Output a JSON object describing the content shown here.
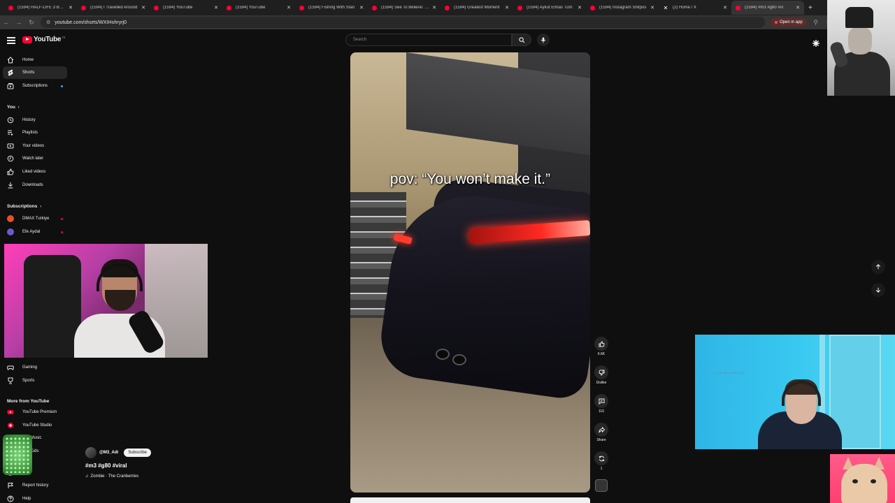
{
  "browser": {
    "tabs": [
      {
        "label": "(1594) HALF-LIFE 3 BU Ç",
        "active": false
      },
      {
        "label": "(1594) I Travelled Around",
        "active": false
      },
      {
        "label": "(1594) YouTube",
        "active": false
      },
      {
        "label": "(1594) YouTube",
        "active": false
      },
      {
        "label": "(1594) Fishing With Stan",
        "active": false
      },
      {
        "label": "(1594) See To Believe: De",
        "active": false
      },
      {
        "label": "(1594) Greatest Moment",
        "active": false
      },
      {
        "label": "(1594) Aykut Elmas Tüm",
        "active": false
      },
      {
        "label": "(1594) Instagram Shitpos",
        "active": false
      },
      {
        "label": "(2) Home / X",
        "active": false
      },
      {
        "label": "(1594) #m3 #g80 #vi",
        "active": true
      }
    ],
    "url": "youtube.com/shorts/WXIHohryrj0",
    "open_in_app": "Open in app"
  },
  "header": {
    "logo_text": "YouTube",
    "logo_country": "TR",
    "search_placeholder": "Search"
  },
  "sidebar": {
    "main": [
      {
        "label": "Home",
        "icon": "home-icon"
      },
      {
        "label": "Shorts",
        "icon": "shorts-icon",
        "active": true
      },
      {
        "label": "Subscriptions",
        "icon": "subscriptions-icon"
      }
    ],
    "you_heading": "You",
    "you": [
      {
        "label": "History",
        "icon": "history-icon"
      },
      {
        "label": "Playlists",
        "icon": "playlists-icon"
      },
      {
        "label": "Your videos",
        "icon": "your-videos-icon"
      },
      {
        "label": "Watch later",
        "icon": "watch-later-icon"
      },
      {
        "label": "Liked videos",
        "icon": "liked-videos-icon"
      },
      {
        "label": "Downloads",
        "icon": "downloads-icon"
      }
    ],
    "subs_heading": "Subscriptions",
    "subscriptions": [
      {
        "label": "DMAX Turkiye",
        "color": "#e8502a"
      },
      {
        "label": "Efe Aydal",
        "color": "#6a5acd"
      }
    ],
    "explore": [
      {
        "label": "Gaming",
        "icon": "gaming-icon"
      },
      {
        "label": "Sports",
        "icon": "sports-icon"
      }
    ],
    "more_heading": "More from YouTube",
    "more": [
      {
        "label": "YouTube Premium",
        "icon": "youtube-premium-icon"
      },
      {
        "label": "YouTube Studio",
        "icon": "youtube-studio-icon"
      },
      {
        "label": "ube Music",
        "icon": "youtube-music-icon"
      },
      {
        "label": "ube Kids",
        "icon": "youtube-kids-icon"
      }
    ],
    "bottom": [
      {
        "label": "ings",
        "icon": "settings-icon"
      },
      {
        "label": "Report history",
        "icon": "report-history-icon"
      },
      {
        "label": "Help",
        "icon": "help-icon"
      }
    ]
  },
  "short": {
    "caption": "pov: “You won’t make it.”",
    "channel_handle": "@M3_Adi",
    "subscribe_label": "Subscribe",
    "title": "#m3 #g80 #viral",
    "song": "Zombie · The Cranberries"
  },
  "actions": {
    "like_count": "6.6K",
    "dislike_label": "Dislike",
    "comments_count": "116",
    "share_label": "Share",
    "remix_count": "1"
  },
  "overlay_note": "yorum·ndo·dzam·yap"
}
